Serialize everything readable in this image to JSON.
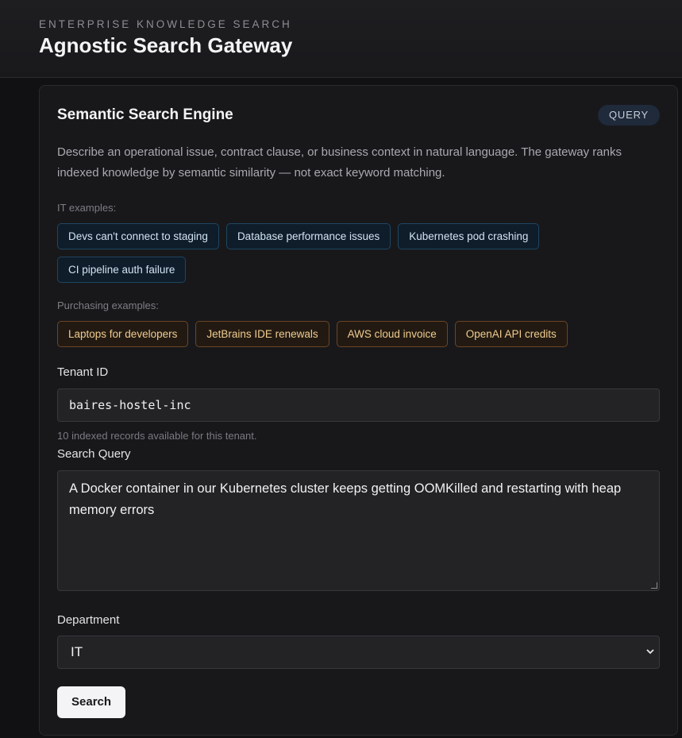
{
  "header": {
    "eyebrow": "ENTERPRISE KNOWLEDGE SEARCH",
    "title": "Agnostic Search Gateway"
  },
  "card": {
    "title": "Semantic Search Engine",
    "badge": "QUERY",
    "description": "Describe an operational issue, contract clause, or business context in natural language. The gateway ranks indexed knowledge by semantic similarity — not exact keyword matching."
  },
  "it_examples": {
    "label": "IT examples:",
    "chips": [
      "Devs can't connect to staging",
      "Database performance issues",
      "Kubernetes pod crashing",
      "CI pipeline auth failure"
    ]
  },
  "purchasing_examples": {
    "label": "Purchasing examples:",
    "chips": [
      "Laptops for developers",
      "JetBrains IDE renewals",
      "AWS cloud invoice",
      "OpenAI API credits"
    ]
  },
  "form": {
    "tenant_label": "Tenant ID",
    "tenant_value": "baires-hostel-inc",
    "tenant_hint": "10 indexed records available for this tenant.",
    "query_label": "Search Query",
    "query_value": "A Docker container in our Kubernetes cluster keeps getting OOMKilled and restarting with heap memory errors",
    "department_label": "Department",
    "department_value": "IT",
    "search_button": "Search"
  },
  "colors": {
    "background": "#111113",
    "card": "#18181b",
    "it_chip_border": "#1f4560",
    "purchasing_chip_border": "#6b4524",
    "button": "#f4f4f6"
  },
  "icons": {
    "select_arrow": "chevron-down-icon",
    "textarea_resize": "resize-grip-icon"
  }
}
